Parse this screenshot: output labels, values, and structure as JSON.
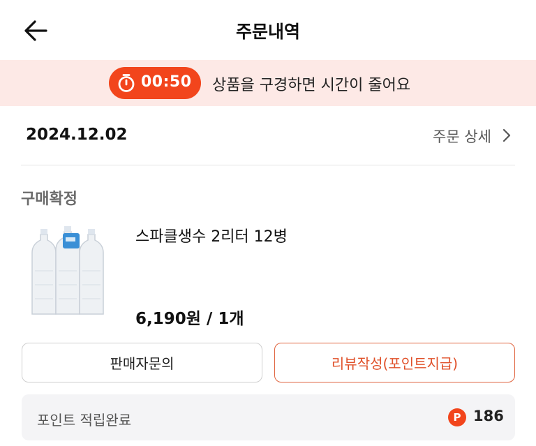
{
  "header": {
    "title": "주문내역",
    "back_icon": "arrow-left-icon"
  },
  "banner": {
    "timer": "00:50",
    "message": "상품을 구경하면 시간이 줄어요",
    "accent": "#f2451c",
    "background": "#fde9e6"
  },
  "order": {
    "date": "2024.12.02",
    "detail_link": "주문 상세",
    "status": "구매확정",
    "product": {
      "name": "스파클생수 2리터 12병",
      "price": "6,190원 / 1개",
      "image": "water-bottles-image"
    }
  },
  "actions": {
    "seller_inquiry": "판매자문의",
    "write_review": "리뷰작성(포인트지급)"
  },
  "points": {
    "label": "포인트 적립완료",
    "badge": "P",
    "value": "186"
  }
}
